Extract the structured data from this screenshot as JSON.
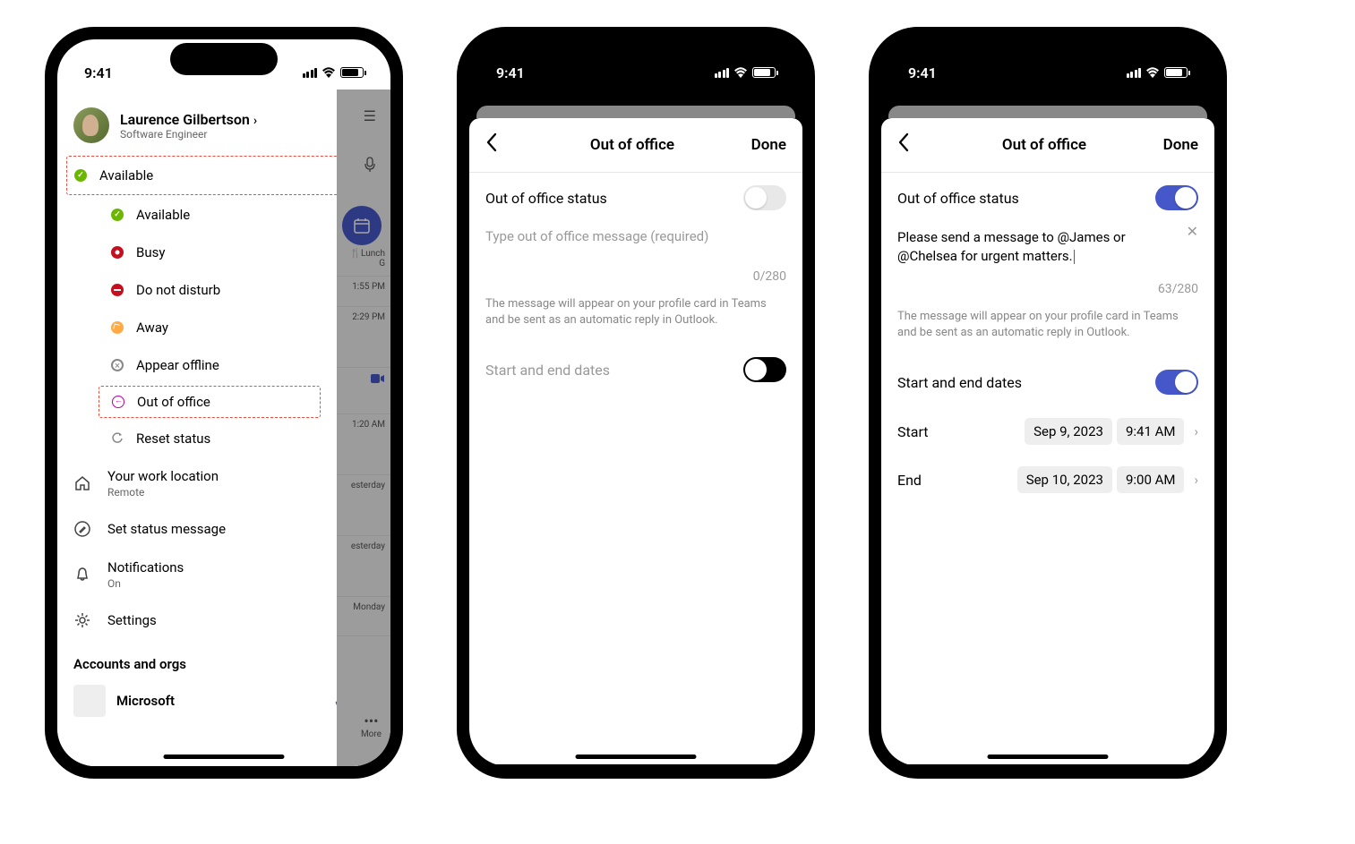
{
  "status_bar": {
    "time": "9:41"
  },
  "phone1": {
    "profile": {
      "name": "Laurence Gilbertson",
      "title": "Software Engineer"
    },
    "current_status_label": "Available",
    "status_options": {
      "available": "Available",
      "busy": "Busy",
      "dnd": "Do not disturb",
      "away": "Away",
      "offline": "Appear offline",
      "ooo": "Out of office",
      "reset": "Reset status"
    },
    "menu": {
      "work_location_label": "Your work location",
      "work_location_value": "Remote",
      "set_status_msg": "Set status message",
      "notifications_label": "Notifications",
      "notifications_value": "On",
      "settings": "Settings"
    },
    "accounts_section": "Accounts and orgs",
    "org_name": "Microsoft",
    "behind": {
      "lunch": "🍴Lunch G",
      "t1": "1:55 PM",
      "t2": "2:29 PM",
      "t3": "1:20 AM",
      "y1": "esterday",
      "y2": "esterday",
      "mon": "Monday",
      "more": "More"
    }
  },
  "phone2": {
    "title": "Out of office",
    "done": "Done",
    "status_label": "Out of office status",
    "placeholder": "Type out of office message (required)",
    "counter": "0/280",
    "hint": "The message will appear on your profile card in Teams and be sent as an automatic reply in Outlook.",
    "dates_label": "Start and end dates"
  },
  "phone3": {
    "title": "Out of office",
    "done": "Done",
    "status_label": "Out of office status",
    "message": "Please send a message to @James or @Chelsea for urgent matters.",
    "counter": "63/280",
    "hint": "The message will appear on your profile card in Teams and be sent as an automatic reply in Outlook.",
    "dates_label": "Start and end dates",
    "start_label": "Start",
    "start_date": "Sep 9, 2023",
    "start_time": "9:41 AM",
    "end_label": "End",
    "end_date": "Sep 10, 2023",
    "end_time": "9:00 AM"
  }
}
